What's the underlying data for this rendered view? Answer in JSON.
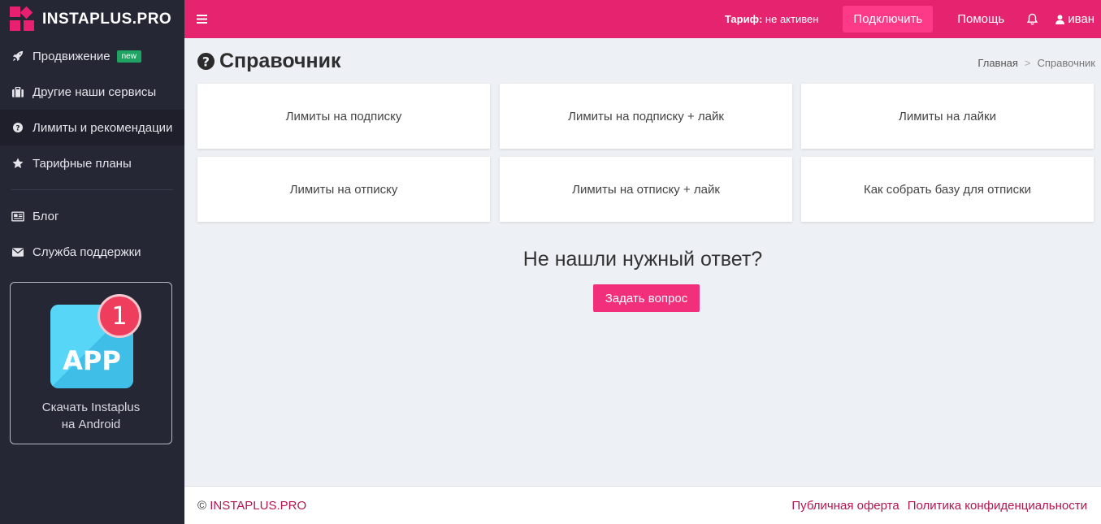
{
  "brand": {
    "name": "INSTAPLUS.PRO",
    "accent": "#e6236f",
    "sidebar_bg": "#262735"
  },
  "sidebar": {
    "items": [
      {
        "label": "Продвижение",
        "icon": "rocket-icon",
        "badge": "new"
      },
      {
        "label": "Другие наши сервисы",
        "icon": "briefcase-icon"
      },
      {
        "label": "Лимиты и рекомендации",
        "icon": "question-circle-icon",
        "active": true
      },
      {
        "label": "Тарифные планы",
        "icon": "star-icon"
      },
      {
        "label": "Блог",
        "icon": "newspaper-icon"
      },
      {
        "label": "Служба поддержки",
        "icon": "envelope-icon"
      }
    ],
    "app_promo": {
      "icon_text": "APP",
      "notification": "1",
      "caption_line1": "Скачать Instaplus",
      "caption_line2": "на Android"
    }
  },
  "topbar": {
    "tariff_label": "Тариф:",
    "tariff_value": "не активен",
    "connect_label": "Подключить",
    "help_label": "Помощь",
    "user_name": "иван"
  },
  "page": {
    "title": "Справочник",
    "breadcrumb": [
      "Главная",
      "Справочник"
    ]
  },
  "cards": [
    "Лимиты на подписку",
    "Лимиты на подписку + лайк",
    "Лимиты на лайки",
    "Лимиты на отписку",
    "Лимиты на отписку + лайк",
    "Как собрать базу для отписки"
  ],
  "help": {
    "question": "Не нашли нужный ответ?",
    "ask_button": "Задать вопрос"
  },
  "footer": {
    "copyright_symbol": "©",
    "brand": "INSTAPLUS.PRO",
    "links": [
      "Публичная оферта",
      "Политика конфиденциальности"
    ]
  }
}
